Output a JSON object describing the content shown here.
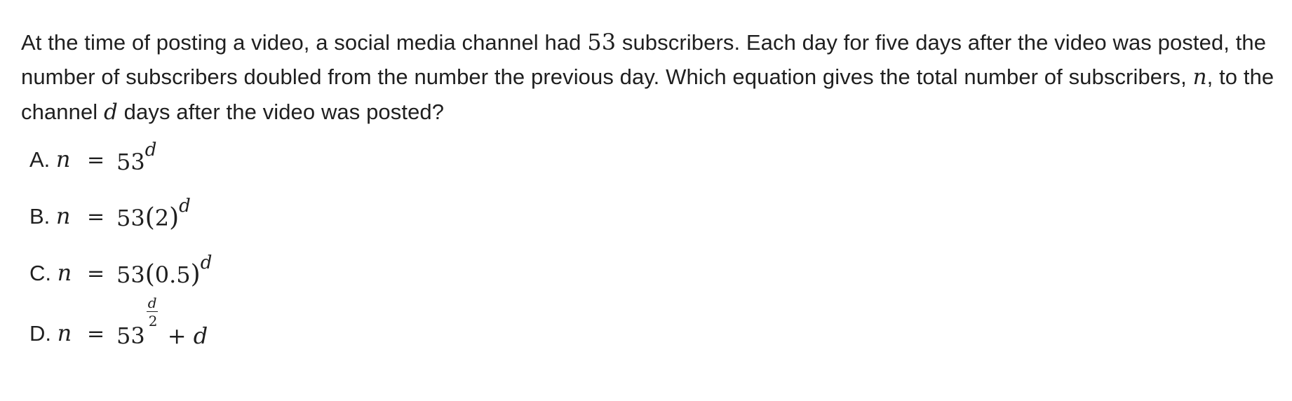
{
  "question": {
    "seg1": "At the time of posting a video, a social media channel had ",
    "num53": "53",
    "seg2": " subscribers. Each day for five days after the video was posted, the number of subscribers doubled from the number the previous day. Which equation gives the total number of subscribers, ",
    "var_n": "n",
    "seg3": ", to the channel ",
    "var_d": "d",
    "seg4": " days after the video was posted?"
  },
  "choices": [
    {
      "letter": "A.",
      "var": "n",
      "eq": "=",
      "base": "53",
      "exp": "d"
    },
    {
      "letter": "B.",
      "var": "n",
      "eq": "=",
      "base": "53",
      "open": "(",
      "inner": "2",
      "close": ")",
      "exp": "d"
    },
    {
      "letter": "C.",
      "var": "n",
      "eq": "=",
      "base": "53",
      "open": "(",
      "inner": "0.5",
      "close": ")",
      "exp": "d"
    },
    {
      "letter": "D.",
      "var": "n",
      "eq": "=",
      "base": "53",
      "frac_num": "d",
      "frac_den": "2",
      "tail": "+ d"
    }
  ]
}
